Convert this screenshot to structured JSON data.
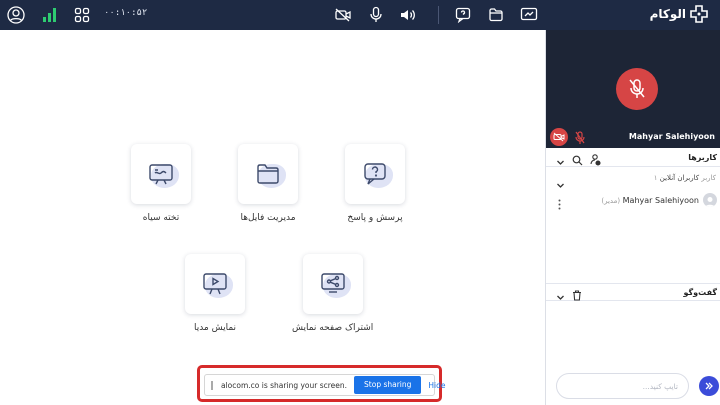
{
  "topbar": {
    "timer": "۰۰:۱۰:۵۲",
    "logo_text": "الوکام"
  },
  "tiles": {
    "whiteboard": "تخته سیاه",
    "files": "مدیریت فایل‌ها",
    "qa": "پرسش و پاسخ",
    "media": "نمایش مدیا",
    "screen": "اشتراک صفحه نمایش"
  },
  "share_bar": {
    "message": "alocom.co is sharing your screen.",
    "stop_label": "Stop sharing",
    "hide_label": "Hide"
  },
  "video": {
    "participant_name": "Mahyar Salehiyoon"
  },
  "users_panel": {
    "title": "کاربرها",
    "online_label": "کاربران آنلاین",
    "online_count": "۱ کاربر",
    "users": [
      {
        "name": "Mahyar Salehiyoon",
        "role": "(مدیر)"
      }
    ]
  },
  "chat_panel": {
    "title": "گفت‌وگو",
    "input_placeholder": "تایپ کنید..."
  },
  "colors": {
    "topbar_bg": "#1e2a44",
    "accent_red": "#d64545",
    "accent_blue": "#3b4cd9",
    "share_outline": "#d62a2a",
    "stop_button": "#1a73e8",
    "signal_green": "#2ecc71"
  }
}
